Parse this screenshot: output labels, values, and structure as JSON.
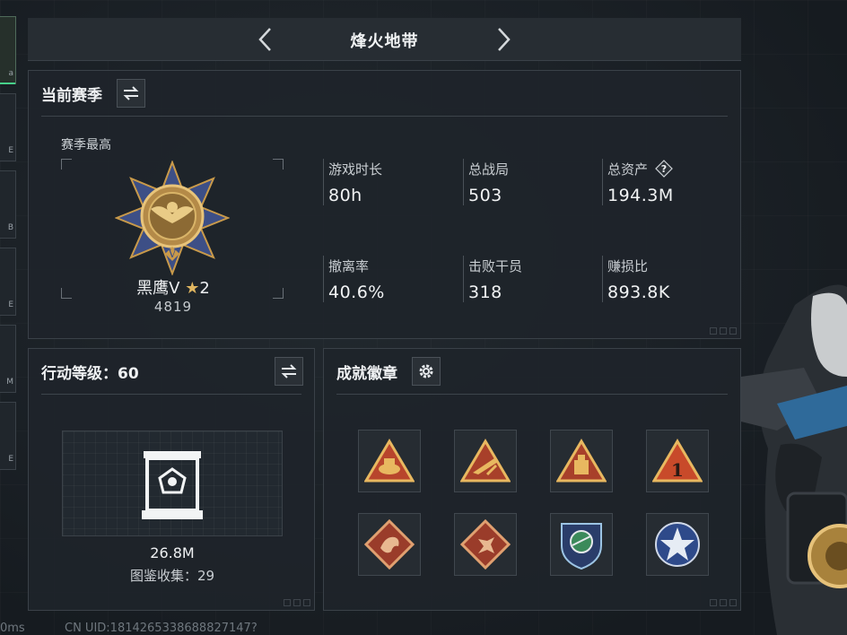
{
  "header": {
    "title": "烽火地带"
  },
  "rail": {
    "glyphs": [
      "a",
      "E",
      "B",
      "E",
      "M",
      "E"
    ]
  },
  "season": {
    "title": "当前赛季",
    "peak_label": "赛季最高",
    "rank_name": "黑鹰V",
    "rank_stars": "2",
    "rank_score": "4819",
    "stats": [
      {
        "label": "游戏时长",
        "value": "80h"
      },
      {
        "label": "总战局",
        "value": "503"
      },
      {
        "label": "总资产",
        "value": "194.3M",
        "has_help": true
      },
      {
        "label": "撤离率",
        "value": "40.6%"
      },
      {
        "label": "击败干员",
        "value": "318"
      },
      {
        "label": "赚损比",
        "value": "893.8K"
      }
    ]
  },
  "level": {
    "title": "行动等级：60",
    "vault_value": "26.8M",
    "collection_label": "图鉴收集：29"
  },
  "achievements": {
    "title": "成就徽章",
    "badges": [
      "ration-badge",
      "rifle-badge",
      "supply-badge",
      "rank-one-badge",
      "dragon-badge",
      "beast-badge",
      "shield-badge",
      "star-badge"
    ]
  },
  "footer": {
    "ping": "0ms",
    "uid": "CN UID:1814265338688827147?"
  },
  "colors": {
    "accent": "#46d08a",
    "gold": "#c99a4a",
    "panel": "#1e242a"
  }
}
